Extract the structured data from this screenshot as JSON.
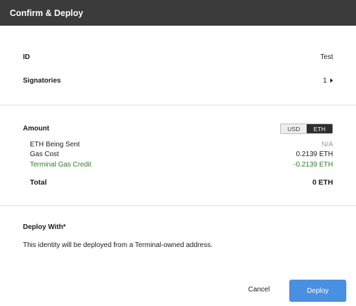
{
  "header": {
    "title": "Confirm & Deploy"
  },
  "details": {
    "id_label": "ID",
    "id_value": "Test",
    "signatories_label": "Signatories",
    "signatories_value": "1"
  },
  "amount": {
    "label": "Amount",
    "currency_options": [
      "USD",
      "ETH"
    ],
    "selected_currency": "ETH",
    "lines": [
      {
        "label": "ETH Being Sent",
        "value": "N/A"
      },
      {
        "label": "Gas Cost",
        "value": "0.2139 ETH"
      },
      {
        "label": "Terminal Gas Credit",
        "value": "-0.2139 ETH"
      }
    ],
    "total_label": "Total",
    "total_value": "0 ETH"
  },
  "deploy": {
    "label": "Deploy With*",
    "description": "This identity will be deployed from a Terminal-owned address."
  },
  "buttons": {
    "cancel": "Cancel",
    "deploy": "Deploy"
  },
  "colors": {
    "header_bg": "#3b3b3b",
    "accent": "#4a90e2",
    "credit": "#2e7d1f",
    "muted": "#9a9a9a"
  }
}
